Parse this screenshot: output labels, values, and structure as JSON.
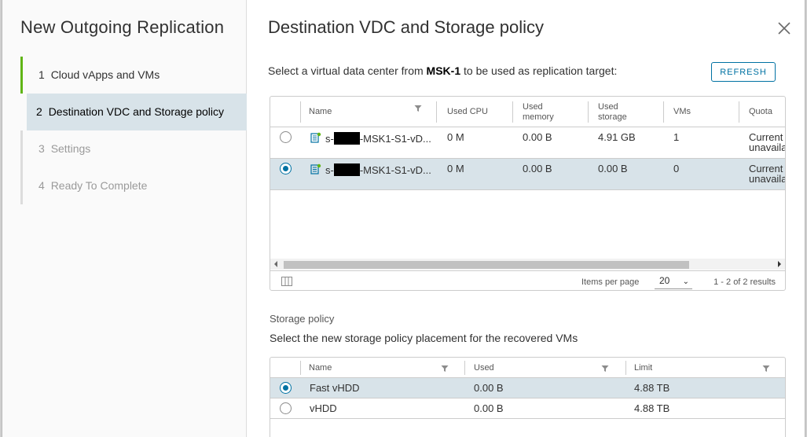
{
  "wizard": {
    "title": "New Outgoing Replication",
    "steps": [
      {
        "num": "1",
        "label": "Cloud vApps and VMs",
        "state": "done"
      },
      {
        "num": "2",
        "label": "Destination VDC and Storage policy",
        "state": "active"
      },
      {
        "num": "3",
        "label": "Settings",
        "state": "pending"
      },
      {
        "num": "4",
        "label": "Ready To Complete",
        "state": "pending"
      }
    ]
  },
  "page": {
    "title": "Destination VDC and Storage policy",
    "instruction_prefix": "Select a virtual data center from ",
    "instruction_site": "MSK-1",
    "instruction_suffix": " to be used as replication target:",
    "refresh_label": "REFRESH"
  },
  "vdc_grid": {
    "columns": {
      "name": "Name",
      "used_cpu": "Used CPU",
      "used_memory": "Used memory",
      "used_storage": "Used storage",
      "vms": "VMs",
      "quota": "Quota"
    },
    "rows": [
      {
        "name_prefix": "s-",
        "name_suffix": "-MSK1-S1-vD...",
        "used_cpu": "0 M",
        "used_memory": "0.00 B",
        "used_storage": "4.91 GB",
        "vms": "1",
        "quota_line1": "Current",
        "quota_line2": "unavaila",
        "selected": false
      },
      {
        "name_prefix": "s-",
        "name_suffix": "-MSK1-S1-vD...",
        "used_cpu": "0 M",
        "used_memory": "0.00 B",
        "used_storage": "0.00 B",
        "vms": "0",
        "quota_line1": "Current",
        "quota_line2": "unavaila",
        "selected": true
      }
    ],
    "footer": {
      "items_per_page_label": "Items per page",
      "items_per_page_value": "20",
      "pagination": "1 - 2 of 2 results"
    }
  },
  "storage": {
    "section_label": "Storage policy",
    "description": "Select the new storage policy placement for the recovered VMs",
    "columns": {
      "name": "Name",
      "used": "Used",
      "limit": "Limit"
    },
    "rows": [
      {
        "name": "Fast vHDD",
        "used": "0.00 B",
        "limit": "4.88 TB",
        "selected": true
      },
      {
        "name": "vHDD",
        "used": "0.00 B",
        "limit": "4.88 TB",
        "selected": false
      }
    ]
  },
  "colors": {
    "accent": "#0072a3",
    "done_step": "#60b515",
    "selected_row": "#d8e3e9"
  }
}
